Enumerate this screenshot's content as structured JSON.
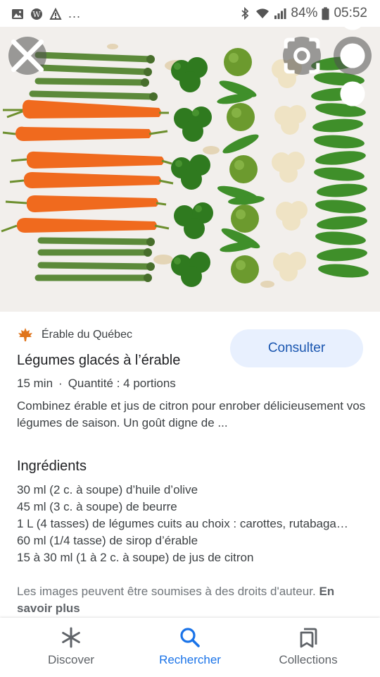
{
  "status_bar": {
    "battery": "84%",
    "time": "05:52",
    "overflow": "..."
  },
  "icons": {
    "close": "close-icon",
    "lens": "lens-icon",
    "more": "more-vert-icon",
    "source_logo": "maple-leaf-icon",
    "discover": "asterisk-icon",
    "search": "search-icon",
    "collections": "bookmarks-icon"
  },
  "result": {
    "source": "Érable du Québec",
    "title": "Légumes glacés à l’érable",
    "time": "15 min",
    "separator": "·",
    "servings": "Quantité : 4 portions",
    "description": "Combinez érable et jus de citron pour enrober délicieusement vos légumes de saison. Un goût digne de ...",
    "action_label": "Consulter",
    "ingredients_title": "Ingrédients",
    "ingredients": [
      "30 ml (2 c. à soupe) d’huile d’olive",
      "45 ml (3 c. à soupe) de beurre",
      "1 L (4 tasses) de légumes cuits au choix : carottes, rutabaga…",
      "60 ml (1/4 tasse) de sirop d’érable",
      "15 à 30 ml (1 à 2 c. à soupe) de jus de citron"
    ],
    "notice": "Les images peuvent être soumises à des droits d'auteur.",
    "learn_more": "En savoir plus"
  },
  "bottom_nav": {
    "discover": "Discover",
    "search": "Rechercher",
    "collections": "Collections",
    "active": "search"
  },
  "colors": {
    "accent": "#1a73e8",
    "consult_bg": "#e8f0fe",
    "consult_text": "#1a56b0",
    "carrot": "#f06a1e",
    "asparagus": "#5c8a3a",
    "broccoli": "#2f7a1f",
    "cauliflower": "#efe3c4",
    "pea_pod": "#3f8f2a"
  }
}
